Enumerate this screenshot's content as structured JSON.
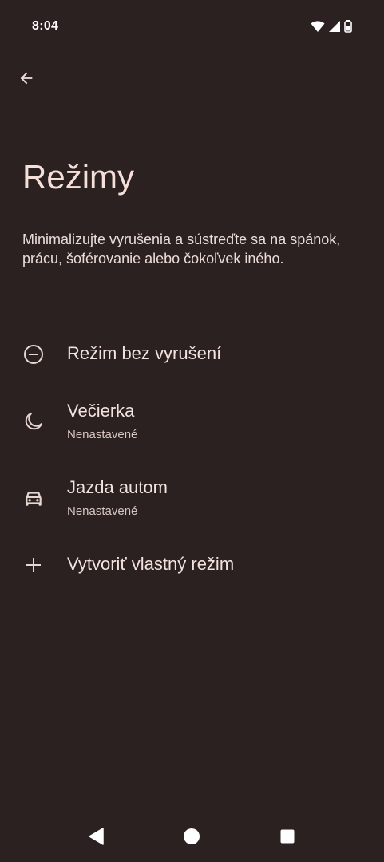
{
  "status_bar": {
    "time": "8:04",
    "icons": [
      "wifi-icon",
      "signal-icon",
      "battery-icon"
    ]
  },
  "header": {
    "back_icon": "arrow-back-icon"
  },
  "page": {
    "title": "Režimy",
    "description": "Minimalizujte vyrušenia a sústreďte sa na spánok, prácu, šoférovanie alebo čokoľvek iného."
  },
  "modes": [
    {
      "icon": "do-not-disturb-icon",
      "title": "Režim bez vyrušení",
      "subtitle": ""
    },
    {
      "icon": "moon-icon",
      "title": "Večierka",
      "subtitle": "Nenastavené"
    },
    {
      "icon": "car-icon",
      "title": "Jazda autom",
      "subtitle": "Nenastavené"
    },
    {
      "icon": "plus-icon",
      "title": "Vytvoriť vlastný režim",
      "subtitle": ""
    }
  ],
  "nav_bar": {
    "buttons": [
      "back-triangle-icon",
      "home-circle-icon",
      "recents-square-icon"
    ]
  },
  "colors": {
    "background": "#2a2120",
    "text_primary": "#f3e2de",
    "text_secondary": "#d9c5c0"
  }
}
